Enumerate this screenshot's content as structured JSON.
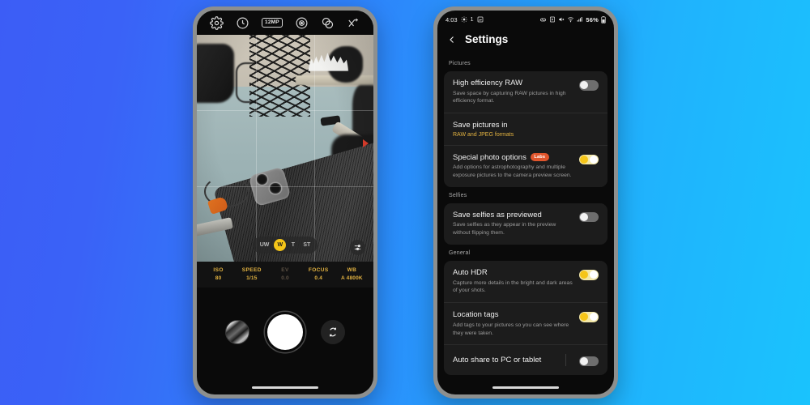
{
  "background": {
    "from": "#3c5df6",
    "to": "#1ac3fd"
  },
  "left_phone": {
    "app": "Camera",
    "toolbar": [
      {
        "name": "settings-gear",
        "label": "Settings"
      },
      {
        "name": "timer",
        "label": "Timer"
      },
      {
        "name": "resolution",
        "label": "12MP"
      },
      {
        "name": "exposure-metering",
        "label": "Metering"
      },
      {
        "name": "filters",
        "label": "Filters"
      },
      {
        "name": "more-options",
        "label": "More"
      }
    ],
    "zoom_levels": [
      {
        "label": "UW",
        "active": false
      },
      {
        "label": "W",
        "active": true
      },
      {
        "label": "T",
        "active": false
      },
      {
        "label": "ST",
        "active": false
      }
    ],
    "slider_button": "pro-slider-icon",
    "pro_values": [
      {
        "key": "ISO",
        "value": "80",
        "enabled": true
      },
      {
        "key": "SPEED",
        "value": "1/15",
        "enabled": true
      },
      {
        "key": "EV",
        "value": "0.0",
        "enabled": false
      },
      {
        "key": "FOCUS",
        "value": "0.4",
        "enabled": true
      },
      {
        "key": "WB",
        "value": "A 4800K",
        "enabled": true
      }
    ],
    "controls": {
      "gallery": "gallery-thumbnail",
      "shutter": "shutter-button",
      "flip": "flip-camera-button"
    }
  },
  "right_phone": {
    "status_bar": {
      "time": "4:03",
      "left_icons": [
        "location-icon",
        "notification-count-1",
        "screenshot-icon"
      ],
      "right_icons": [
        "link-icon",
        "nfc-icon",
        "mute-icon",
        "wifi-icon",
        "signal-icon"
      ],
      "battery": "56%"
    },
    "header": {
      "back": "back-chevron",
      "title": "Settings"
    },
    "sections": [
      {
        "label": "Pictures",
        "rows": [
          {
            "title": "High efficiency RAW",
            "desc": "Save space by capturing RAW pictures in high efficiency format.",
            "control": "toggle",
            "state": "off"
          },
          {
            "title": "Save pictures in",
            "value": "RAW and JPEG formats",
            "control": "none"
          },
          {
            "title": "Special photo options",
            "badge": "Labs",
            "desc": "Add options for astrophotography and multiple exposure pictures to the camera preview screen.",
            "control": "toggle",
            "state": "on"
          }
        ]
      },
      {
        "label": "Selfies",
        "rows": [
          {
            "title": "Save selfies as previewed",
            "desc": "Save selfies as they appear in the preview without flipping them.",
            "control": "toggle",
            "state": "off"
          }
        ]
      },
      {
        "label": "General",
        "rows": [
          {
            "title": "Auto HDR",
            "desc": "Capture more details in the bright and dark areas of your shots.",
            "control": "toggle",
            "state": "on"
          },
          {
            "title": "Location tags",
            "desc": "Add tags to your pictures so you can see where they were taken.",
            "control": "toggle",
            "state": "on"
          },
          {
            "title": "Auto share to PC or tablet",
            "control": "toggle",
            "state": "off",
            "simple": true
          }
        ]
      }
    ]
  }
}
